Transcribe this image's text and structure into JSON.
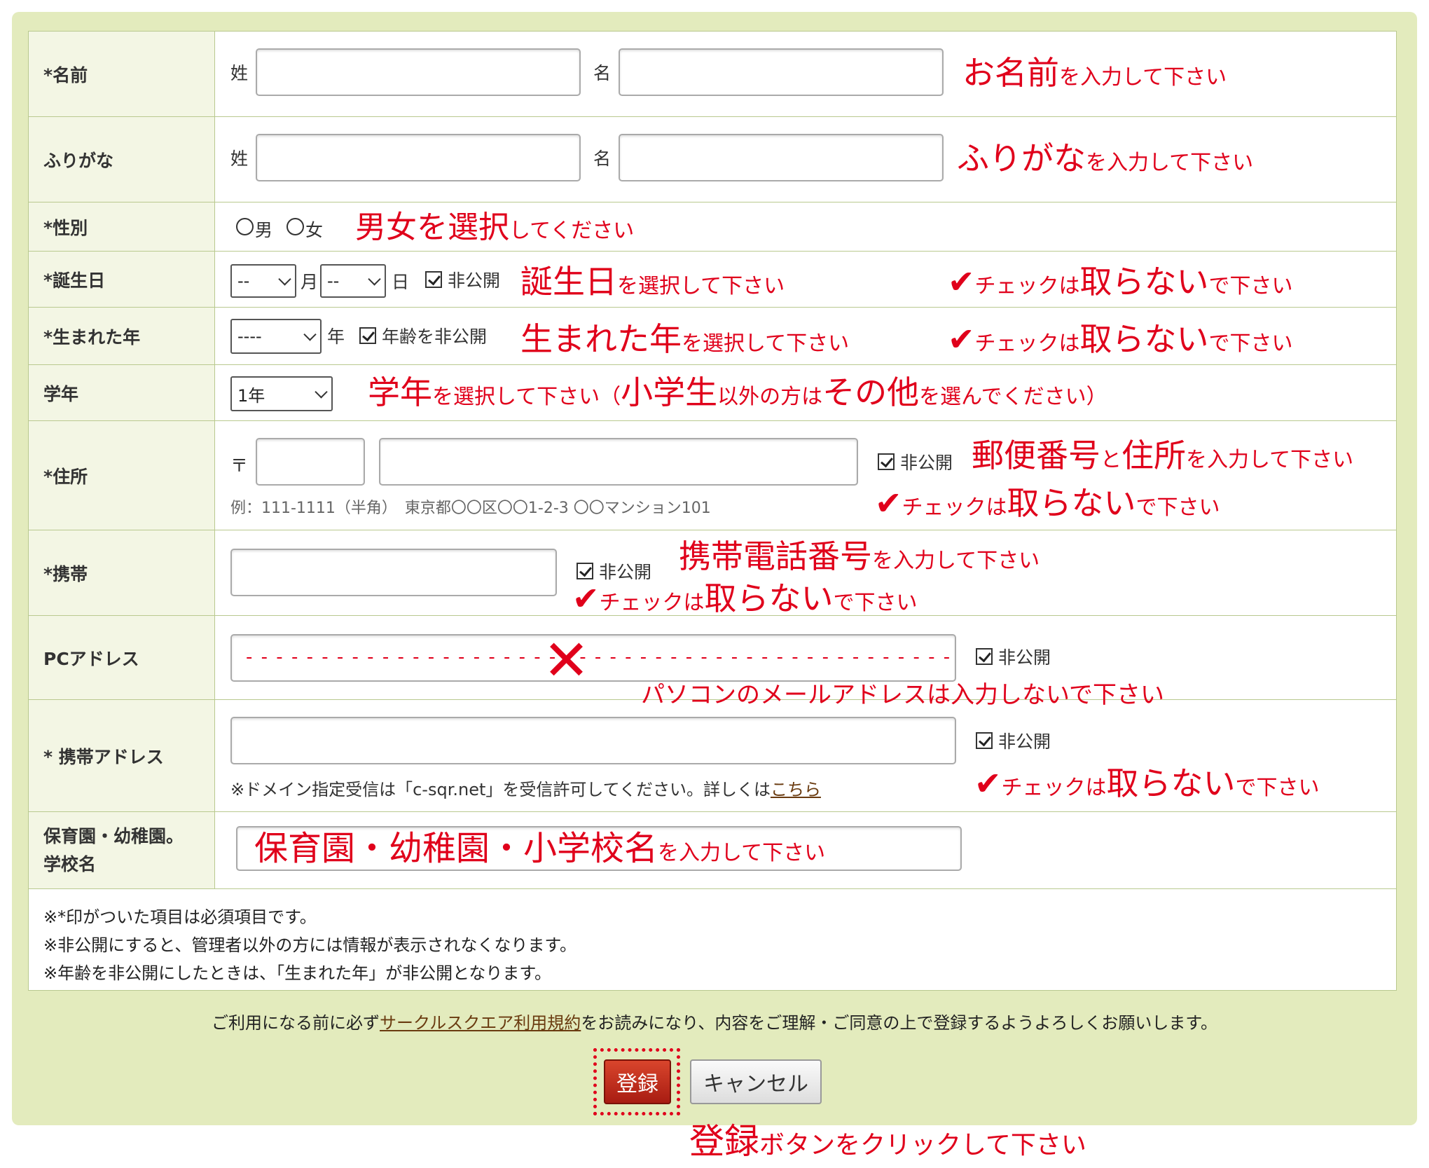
{
  "labels": {
    "name": "*名前",
    "kana": "ふりがな",
    "gender": "*性別",
    "birthday": "*誕生日",
    "birth_year": "*生まれた年",
    "grade": "学年",
    "address": "*住所",
    "mobile": "*携帯",
    "pc_address": "PCアドレス",
    "mobile_address": "* 携帯アドレス",
    "school_line1": "保育園・幼稚園。",
    "school_line2": "学校名"
  },
  "name_row": {
    "last_label": "姓",
    "first_label": "名",
    "hint_big": "お名前",
    "hint_small": "を入力して下さい"
  },
  "kana_row": {
    "last_label": "姓",
    "first_label": "名",
    "hint_big": "ふりがな",
    "hint_small": "を入力して下さい"
  },
  "gender_row": {
    "male": "男",
    "female": "女",
    "hint_big": "男女を選択",
    "hint_small": "してください"
  },
  "birthday_row": {
    "month_value": "--",
    "month_unit": "月",
    "day_value": "--",
    "day_unit": "日",
    "private_label": "非公開",
    "hint_big": "誕生日",
    "hint_small": "を選択して下さい"
  },
  "birth_year_row": {
    "year_value": "----",
    "year_unit": "年",
    "private_label": "年齢を非公開",
    "hint_big": "生まれた年",
    "hint_small": "を選択して下さい"
  },
  "grade_row": {
    "value": "1年",
    "hint_p1": "学年",
    "hint_p2": "を選択して下さい（",
    "hint_p3": "小学生",
    "hint_p4": "以外の方は",
    "hint_p5": "その他",
    "hint_p6": "を選んでください）"
  },
  "address_row": {
    "postal_mark": "〒",
    "private_label": "非公開",
    "example": "例：111-1111（半角）　東京都〇〇区〇〇1-2-3 〇〇マンション101",
    "hint_p1": "郵便番号",
    "hint_p2": "と",
    "hint_p3": "住所",
    "hint_p4": "を入力して下さい"
  },
  "mobile_row": {
    "private_label": "非公開",
    "hint_big": "携帯電話番号",
    "hint_small": "を入力して下さい"
  },
  "pc_row": {
    "dashes": "- - - - - - - - - - - - - - - - - - - - - - - - - - - - - - - - - - - - - - - - - - - - - - -",
    "private_label": "非公開",
    "hint": "パソコンのメールアドレスは入力しないで下さい",
    "cross_mark": "✕"
  },
  "mobile_addr_row": {
    "private_label": "非公開",
    "note_text": "※ドメイン指定受信は「c-sqr.net」を受信許可してください。詳しくは",
    "note_link": "こちら"
  },
  "school_row": {
    "hint_big": "保育園・幼稚園・小学校名",
    "hint_small": "を入力して下さい"
  },
  "keep_check": {
    "mark": "✔",
    "p1": "チェックは",
    "p2": "取らない",
    "p3": "で下さい"
  },
  "notes": [
    "※*印がついた項目は必須項目です。",
    "※非公開にすると、管理者以外の方には情報が表示されなくなります。",
    "※年齢を非公開にしたときは、「生まれた年」が非公開となります。"
  ],
  "terms": {
    "before": "ご利用になる前に必ず",
    "link": "サークルスクエア利用規約",
    "after": "をお読みになり、内容をご理解・ご同意の上で登録するようよろしくお願いします。"
  },
  "buttons": {
    "register": "登録",
    "cancel": "キャンセル"
  },
  "footer_hint": {
    "big": "登録",
    "small": "ボタンをクリックして下さい"
  },
  "colors": {
    "panel": "#e3ebbd",
    "annotation": "#e0001b",
    "register_button": "#b8281c",
    "label_bg": "#f3f6e4"
  }
}
